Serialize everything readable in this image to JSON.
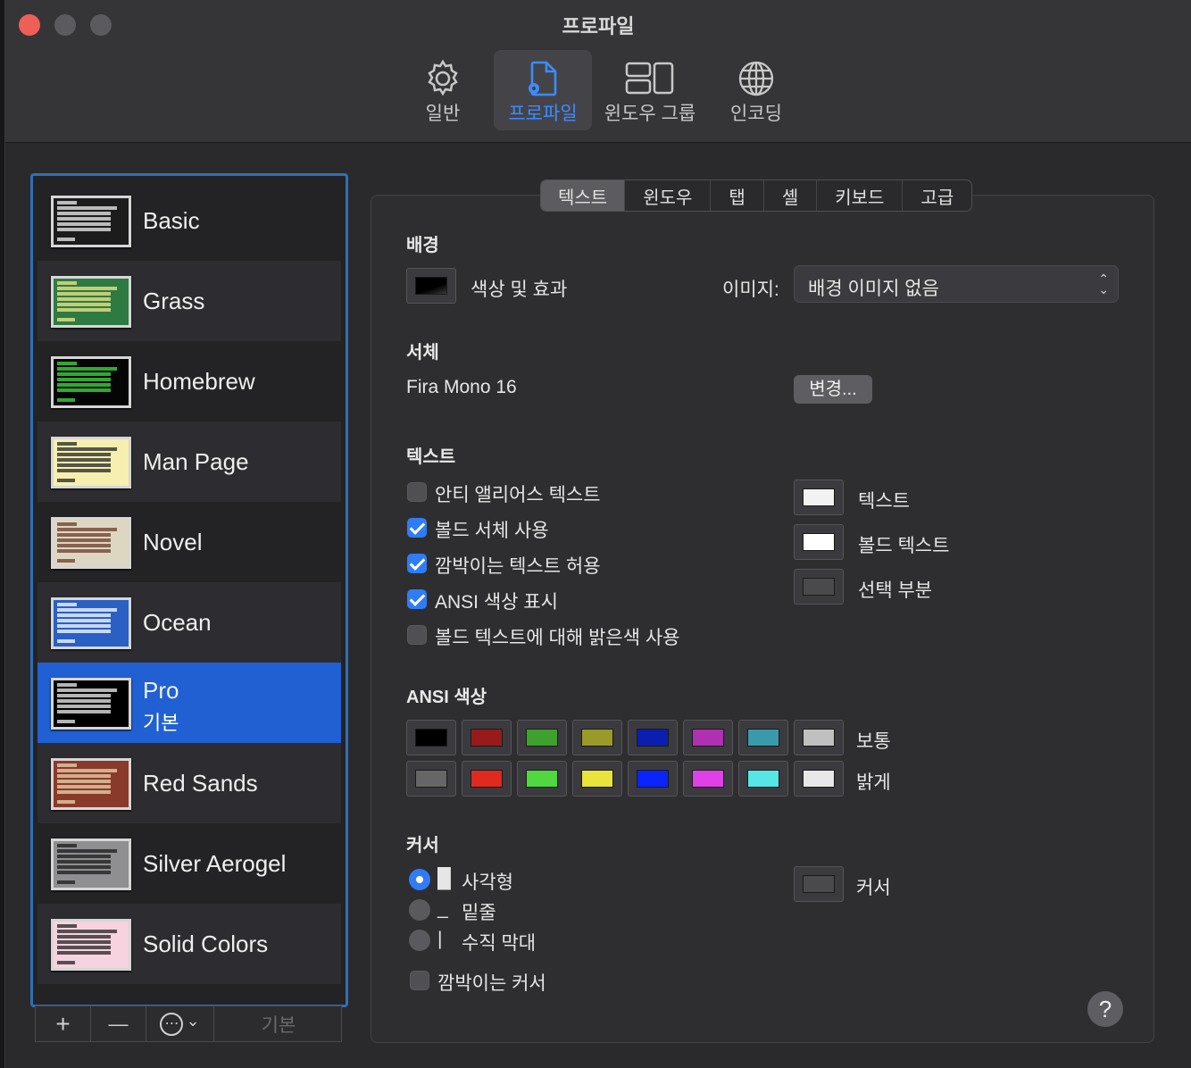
{
  "window": {
    "title": "프로파일"
  },
  "toolbar": {
    "items": [
      {
        "label": "일반",
        "icon": "gear-icon"
      },
      {
        "label": "프로파일",
        "icon": "profile-document-icon",
        "active": true
      },
      {
        "label": "윈도우 그룹",
        "icon": "window-group-icon"
      },
      {
        "label": "인코딩",
        "icon": "globe-icon"
      }
    ]
  },
  "profiles": [
    {
      "name": "Basic",
      "bg": "#1c1c1c",
      "fg": "#f0f0f0"
    },
    {
      "name": "Grass",
      "bg": "#2d7a43",
      "fg": "#f5e98a"
    },
    {
      "name": "Homebrew",
      "bg": "#050505",
      "fg": "#3fe03f"
    },
    {
      "name": "Man Page",
      "bg": "#f7efb0",
      "fg": "#222222"
    },
    {
      "name": "Novel",
      "bg": "#ddd7c2",
      "fg": "#6b3a2a"
    },
    {
      "name": "Ocean",
      "bg": "#2a5fc4",
      "fg": "#ffffff"
    },
    {
      "name": "Pro",
      "sub": "기본",
      "bg": "#000000",
      "fg": "#f0f0f0",
      "selected": true
    },
    {
      "name": "Red Sands",
      "bg": "#8a3a2b",
      "fg": "#e9d7b0"
    },
    {
      "name": "Silver Aerogel",
      "bg": "#8f8f92",
      "fg": "#1a1a1a"
    },
    {
      "name": "Solid Colors",
      "bg": "#f6d3de",
      "fg": "#222222"
    }
  ],
  "sidebar_bar": {
    "add": "+",
    "remove": "—",
    "more": "⋯",
    "more_arrow": "⌄",
    "default": "기본"
  },
  "tabs": [
    "텍스트",
    "윈도우",
    "탭",
    "셸",
    "키보드",
    "고급"
  ],
  "background": {
    "heading": "배경",
    "color_label": "색상 및 효과",
    "image_label": "이미지:",
    "image_value": "배경 이미지 없음",
    "swatch": "#000000"
  },
  "font": {
    "heading": "서체",
    "value": "Fira Mono 16",
    "change": "변경..."
  },
  "text": {
    "heading": "텍스트",
    "options": [
      {
        "label": "안티 앨리어스 텍스트",
        "checked": false
      },
      {
        "label": "볼드 서체 사용",
        "checked": true
      },
      {
        "label": "깜박이는 텍스트 허용",
        "checked": true
      },
      {
        "label": "ANSI 색상 표시",
        "checked": true
      },
      {
        "label": "볼드 텍스트에 대해 밝은색 사용",
        "checked": false
      }
    ],
    "colors": [
      {
        "label": "텍스트",
        "color": "#f2f2f2"
      },
      {
        "label": "볼드 텍스트",
        "color": "#ffffff"
      },
      {
        "label": "선택 부분",
        "color": "#4a4a4c"
      }
    ]
  },
  "ansi": {
    "heading": "ANSI 색상",
    "normal_label": "보통",
    "bright_label": "밝게",
    "normal": [
      "#000000",
      "#991a1a",
      "#3fa12d",
      "#9a9a2a",
      "#0a1fb0",
      "#b030b4",
      "#3a9aab",
      "#c0c0c0"
    ],
    "bright": [
      "#666666",
      "#e0291f",
      "#4fd83f",
      "#e8e43c",
      "#0a24ff",
      "#e040e8",
      "#56e6e6",
      "#e8e8e8"
    ]
  },
  "cursor": {
    "heading": "커서",
    "options": [
      {
        "glyph": "█",
        "label": "사각형",
        "selected": true
      },
      {
        "glyph": "_",
        "label": "밑줄",
        "selected": false
      },
      {
        "glyph": "|",
        "label": "수직 막대",
        "selected": false
      }
    ],
    "blink_label": "깜박이는 커서",
    "blink_checked": false,
    "color_label": "커서",
    "color": "#4a4a4c"
  },
  "help": "?"
}
